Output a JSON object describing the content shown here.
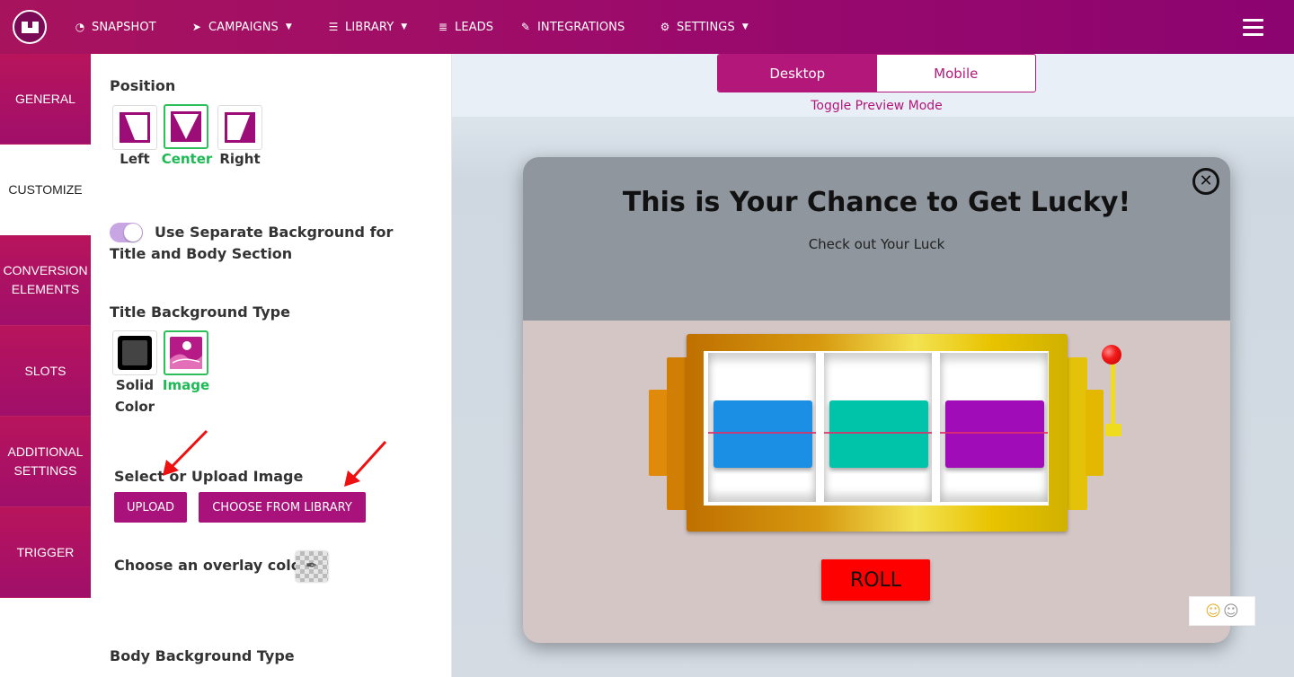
{
  "nav": {
    "items": [
      {
        "label": "SNAPSHOT",
        "icon": "dashboard-icon",
        "dropdown": false
      },
      {
        "label": "CAMPAIGNS",
        "icon": "paper-plane-icon",
        "dropdown": true
      },
      {
        "label": "LIBRARY",
        "icon": "library-icon",
        "dropdown": true
      },
      {
        "label": "LEADS",
        "icon": "list-icon",
        "dropdown": false
      },
      {
        "label": "INTEGRATIONS",
        "icon": "plug-icon",
        "dropdown": false
      },
      {
        "label": "SETTINGS",
        "icon": "cogs-icon",
        "dropdown": true
      }
    ]
  },
  "sidetabs": [
    "GENERAL",
    "CUSTOMIZE",
    "CONVERSION ELEMENTS",
    "SLOTS",
    "ADDITIONAL SETTINGS",
    "TRIGGER"
  ],
  "panel": {
    "position_label": "Position",
    "position_options": [
      "Left",
      "Center",
      "Right"
    ],
    "position_selected": "Center",
    "separate_bg_label": "Use Separate Background for Title and Body Section",
    "separate_bg_on": true,
    "title_bg_label": "Title Background Type",
    "title_bg_options": [
      "Solid Color",
      "Image"
    ],
    "title_bg_selected": "Image",
    "select_upload_label": "Select or Upload Image",
    "upload_btn": "UPLOAD",
    "library_btn": "CHOOSE FROM LIBRARY",
    "overlay_label": "Choose an overlay color",
    "body_bg_label": "Body Background Type"
  },
  "preview": {
    "toggle": [
      "Desktop",
      "Mobile"
    ],
    "toggle_active": "Desktop",
    "toggle_hint": "Toggle Preview Mode",
    "popup_title": "This is Your Chance to Get Lucky!",
    "popup_subtitle": "Check out Your Luck",
    "roll_btn": "ROLL",
    "reel_colors": [
      "#1a8fe3",
      "#00c4aa",
      "#a00cb8"
    ]
  },
  "colors": {
    "brand": "#a8127a",
    "selected": "#1db954",
    "roll": "#ff0000"
  }
}
